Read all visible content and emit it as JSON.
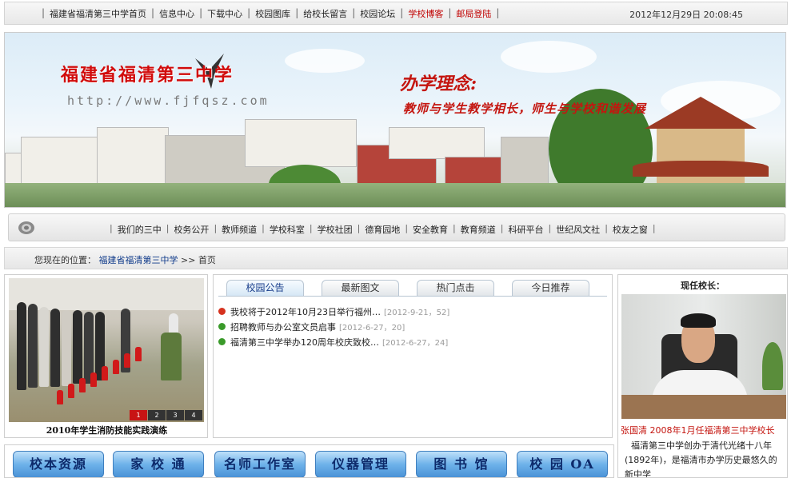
{
  "top_nav": {
    "links": [
      {
        "label": "福建省福清第三中学首页",
        "color": "#222222"
      },
      {
        "label": "信息中心",
        "color": "#222222"
      },
      {
        "label": "下载中心",
        "color": "#222222"
      },
      {
        "label": "校园图库",
        "color": "#222222"
      },
      {
        "label": "给校长留言",
        "color": "#222222"
      },
      {
        "label": "校园论坛",
        "color": "#222222"
      },
      {
        "label": "学校博客",
        "color": "#c00000"
      },
      {
        "label": "邮局登陆",
        "color": "#c00000"
      }
    ],
    "datetime": "2012年12月29日 20:08:45"
  },
  "banner": {
    "school_name": "福建省福清第三中学",
    "url": "http://www.fjfqsz.com",
    "motto_title": "办学理念:",
    "motto_text": "教师与学生教学相长，师生与学校和谐发展"
  },
  "main_nav": {
    "icon": "gear-icon",
    "links": [
      "我们的三中",
      "校务公开",
      "教师频道",
      "学校科室",
      "学校社团",
      "德育园地",
      "安全教育",
      "教育频道",
      "科研平台",
      "世纪风文社",
      "校友之窗"
    ]
  },
  "breadcrumb": {
    "prefix": "您现在的位置：",
    "home": "福建省福清第三中学",
    "separator": ">>",
    "current": "首页"
  },
  "slideshow": {
    "caption": "2010年学生消防技能实践演练",
    "pages": [
      "1",
      "2",
      "3",
      "4"
    ],
    "active_page": "1"
  },
  "news_tabs": {
    "tabs": [
      "校园公告",
      "最新图文",
      "热门点击",
      "今日推荐"
    ],
    "active": "校园公告",
    "items": [
      {
        "title": "我校将于2012年10月23日举行福州…",
        "meta": "[2012-9-21，52]",
        "dot": "red"
      },
      {
        "title": "招聘教师与办公室文员启事",
        "meta": "[2012-6-27，20]",
        "dot": "green"
      },
      {
        "title": "福清第三中学举办120周年校庆致校…",
        "meta": "[2012-6-27，24]",
        "dot": "green"
      }
    ]
  },
  "principal": {
    "title": "现任校长：",
    "name_line": "张国清  2008年1月任福清第三中学校长",
    "description": "福清第三中学创办于清代光绪十八年(1892年)，是福清市办学历史最悠久的新中学"
  },
  "bottom_buttons": [
    "校本资源",
    "家 校 通",
    "名师工作室",
    "仪器管理",
    "图 书 馆",
    "校 园 OA"
  ]
}
